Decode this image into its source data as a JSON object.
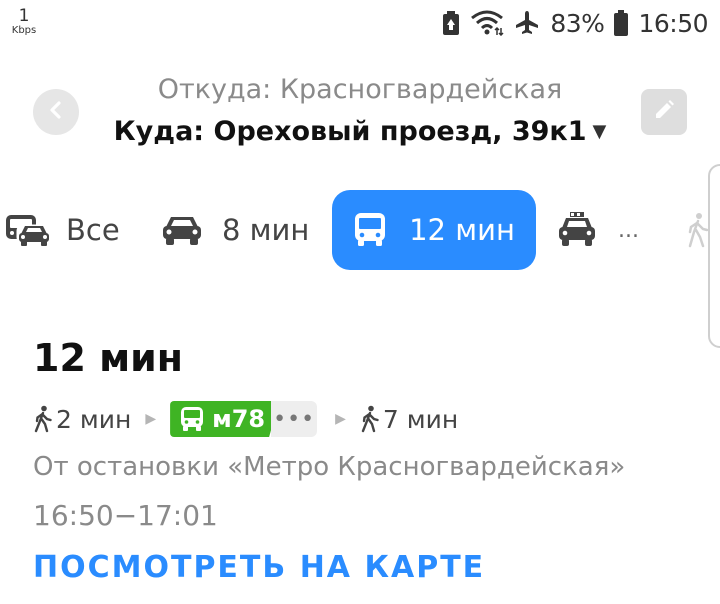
{
  "status_bar": {
    "speed_value": "1",
    "speed_unit": "Kbps",
    "battery_percent": "83%",
    "time": "16:50",
    "icons": [
      "battery-saver-icon",
      "wifi-icon",
      "airplane-mode-icon",
      "battery-icon"
    ]
  },
  "header": {
    "from_text": "Откуда: Красногвардейская",
    "to_text": "Куда: Ореховый проезд, 39к1",
    "back_icon": "chevron-left-icon",
    "edit_icon": "pencil-icon"
  },
  "tabs": [
    {
      "label": "Все",
      "icon": "all-transport-icon",
      "selected": false
    },
    {
      "label": "8 мин",
      "icon": "car-icon",
      "selected": false
    },
    {
      "label": "12 мин",
      "icon": "bus-icon",
      "selected": true
    },
    {
      "label": "...",
      "icon": "taxi-icon",
      "selected": false
    },
    {
      "label": "",
      "icon": "walk-icon",
      "selected": false
    }
  ],
  "route": {
    "total_time": "12 мин",
    "walk_before": "2 мин",
    "bus_number": "м78",
    "more": "•••",
    "walk_after": "7 мин",
    "from_stop": "От остановки «Метро Красногвардейская»",
    "time_range": "16:50−17:01",
    "map_link": "ПОСМОТРЕТЬ НА КАРТЕ"
  },
  "colors": {
    "accent": "#2a8cff",
    "bus_green": "#3fb424",
    "secondary_text": "#8a8a8a"
  }
}
